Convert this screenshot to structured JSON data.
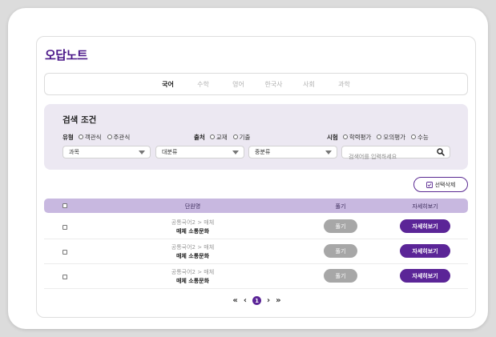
{
  "page": {
    "title": "오답노트"
  },
  "subjects": [
    "국어",
    "수학",
    "영어",
    "한국사",
    "사회",
    "과학"
  ],
  "search": {
    "title": "검색 조건",
    "filters": [
      {
        "label": "유형",
        "options": [
          "객관식",
          "주관식"
        ]
      },
      {
        "label": "출처",
        "options": [
          "교재",
          "기출"
        ]
      },
      {
        "label": "시험",
        "options": [
          "학력평가",
          "모의평가",
          "수능"
        ]
      }
    ],
    "selects": [
      "과목",
      "대분류",
      "중분류"
    ],
    "placeholder": "검색어를 입력하세요"
  },
  "actions": {
    "delete_selected": "선택삭제"
  },
  "table": {
    "headers": {
      "unit": "단원명",
      "solve": "풀기",
      "detail": "자세히보기"
    },
    "rows": [
      {
        "path": "공통국어2 > 매체",
        "name": "매체 소통문화",
        "solve": "풀기",
        "detail": "자세히보기"
      },
      {
        "path": "공통국어2 > 매체",
        "name": "매체 소통문화",
        "solve": "풀기",
        "detail": "자세히보기"
      },
      {
        "path": "공통국어2 > 매체",
        "name": "매체 소통문화",
        "solve": "풀기",
        "detail": "자세히보기"
      }
    ]
  },
  "pagination": {
    "first": "«",
    "prev": "‹",
    "current": "1",
    "next": "›",
    "last": "»"
  },
  "colors": {
    "brand": "#4a1688",
    "accent": "#5b2597",
    "header_bg": "#c8b8e0",
    "search_bg": "#ece8f2"
  }
}
